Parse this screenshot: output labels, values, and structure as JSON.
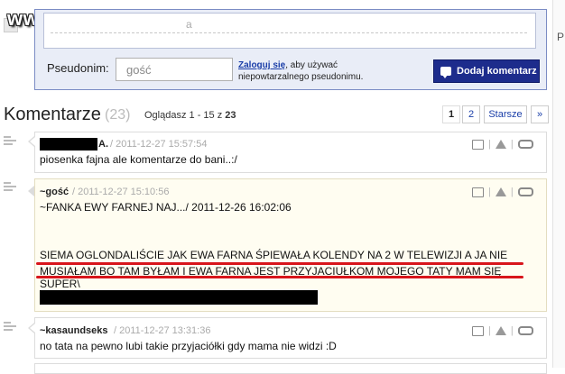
{
  "watermark": "www.wiocha.pl",
  "form": {
    "textarea_placeholder": "a",
    "nick_label": "Pseudonim:",
    "nick_value": "gość",
    "login_link": "Zaloguj się",
    "login_rest": ", aby używać niepowtarzalnego pseudonimu.",
    "submit_label": "Dodaj komentarz"
  },
  "right_edge": "P",
  "header": {
    "title": "Komentarze",
    "count": "(23)",
    "view_prefix": "Oglądasz 1 - 15 z",
    "view_total": "23"
  },
  "pagination": {
    "page1": "1",
    "page2": "2",
    "older": "Starsze",
    "next": "»"
  },
  "comments": [
    {
      "author": "A.",
      "date": "/ 2011-12-27 15:57:54",
      "body": "piosenka fajna ale komentarze do bani..:/"
    },
    {
      "author": "~gość",
      "date": "/ 2011-12-27 15:10:56",
      "quote": "~FANKA EWY FARNEJ NAJ.../ 2011-12-26 16:02:06",
      "body_line1": "SIEMA OGLONDALIŚCIE JAK EWA FARNA ŚPIEWAŁA KOLENDY NA 2 W TELEWIZJI A JA NIE",
      "body_line2": "MUSIAŁAM BO TAM BYŁAM I EWA FARNA JEST PRZYJACIUŁKOM MOJEGO TATY MAM SIĘ",
      "body_line3": "SUPER\\"
    },
    {
      "author": "~kasaundseks",
      "date": "/ 2011-12-27 13:31:36",
      "body": "no tata na pewno lubi takie przyjaciółki gdy mama nie widzi :D"
    }
  ],
  "icons": {
    "reply": "reply-icon",
    "report": "warning-icon",
    "link": "link-icon",
    "submit": "comment-bubble-icon"
  },
  "colors": {
    "button": "#1d2c8c",
    "link": "#1a3ea8",
    "highlight_underline": "#d8151b",
    "highlight_bg": "#fffdf1"
  }
}
